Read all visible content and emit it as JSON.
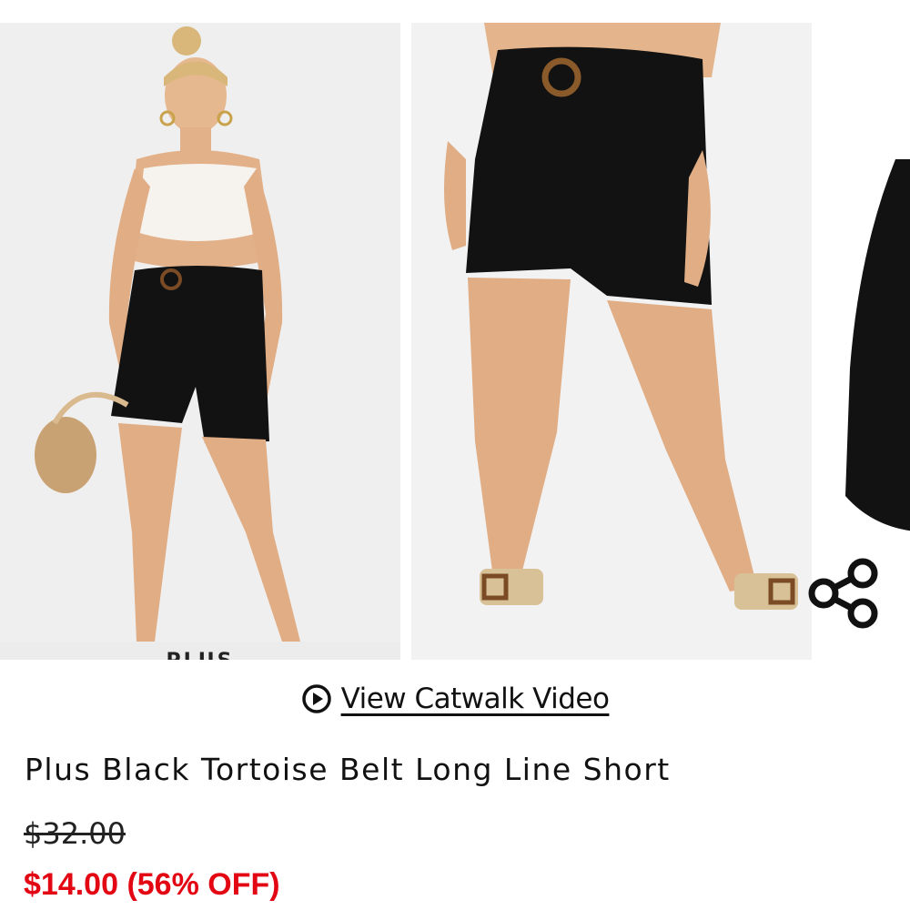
{
  "gallery": {
    "images": [
      {
        "label": "PLUS"
      },
      {},
      {}
    ]
  },
  "share": {
    "icon": "share-icon"
  },
  "catwalk": {
    "icon": "play-circle-icon",
    "label": "View Catwalk Video"
  },
  "product": {
    "title": "Plus Black Tortoise Belt Long Line Short",
    "price_original": "$32.00",
    "price_sale": "$14.00",
    "discount": "(56% OFF)"
  },
  "colors": {
    "sale_price": "#e30613",
    "text": "#111111",
    "image_bg": "#efefef"
  }
}
